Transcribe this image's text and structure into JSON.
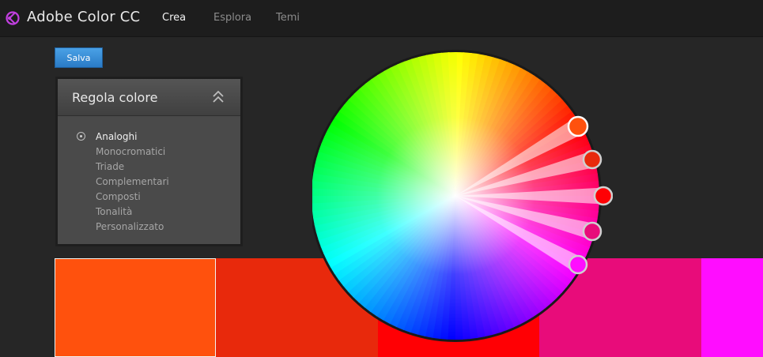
{
  "header": {
    "app_title": "Adobe Color CC",
    "nav": [
      {
        "label": "Crea",
        "active": true
      },
      {
        "label": "Esplora",
        "active": false
      },
      {
        "label": "Temi",
        "active": false
      }
    ]
  },
  "toolbar": {
    "save_label": "Salva"
  },
  "rules_panel": {
    "title": "Regola colore",
    "items": [
      {
        "label": "Analoghi",
        "selected": true
      },
      {
        "label": "Monocromatici",
        "selected": false
      },
      {
        "label": "Triade",
        "selected": false
      },
      {
        "label": "Complementari",
        "selected": false
      },
      {
        "label": "Composti",
        "selected": false
      },
      {
        "label": "Tonalità",
        "selected": false
      },
      {
        "label": "Personalizzato",
        "selected": false
      }
    ]
  },
  "swatches": [
    {
      "color": "#FF510D",
      "active": true
    },
    {
      "color": "#E8290C",
      "active": false
    },
    {
      "color": "#FF0004",
      "active": false
    },
    {
      "color": "#E80C7A",
      "active": false
    },
    {
      "color": "#FF0DFF",
      "active": false
    }
  ],
  "colors": {
    "accent": "#E040FB",
    "save_button": "#2E86D6",
    "topbar": "#1D1D1D",
    "background": "#262626"
  },
  "icons": {
    "logo": "adobe-color-logo-icon",
    "collapse": "double-chevron-up-icon",
    "radio": "radio-selected-icon"
  }
}
